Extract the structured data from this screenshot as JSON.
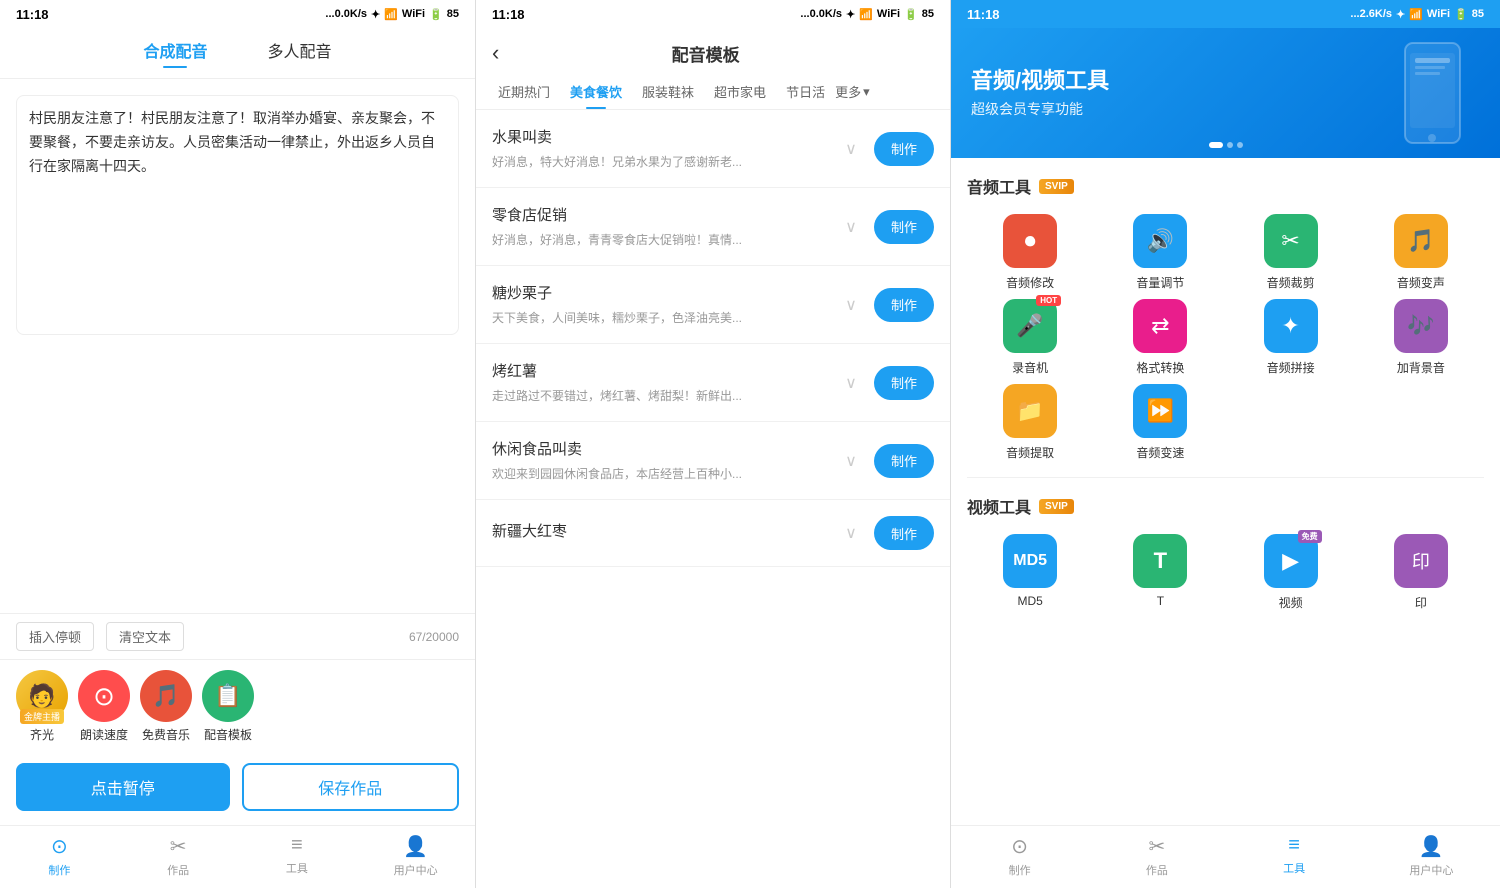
{
  "panel1": {
    "status": {
      "time": "11:18",
      "network": "...0.0K/s",
      "battery": "85"
    },
    "tabs": [
      {
        "label": "合成配音",
        "active": true
      },
      {
        "label": "多人配音",
        "active": false
      }
    ],
    "textarea": {
      "content": "村民朋友注意了！村民朋友注意了！取消举办婚宴、亲友聚会，不要聚餐，不要走亲访友。人员密集活动一律禁止，外出返乡人员自行在家隔离十四天。",
      "placeholder": ""
    },
    "toolbar": {
      "insert_btn": "插入停顿",
      "clear_btn": "清空文本",
      "count": "67/20000"
    },
    "voice_items": [
      {
        "label": "齐光",
        "type": "avatar",
        "badge": "金牌主播"
      },
      {
        "label": "朗读速度",
        "type": "speed"
      },
      {
        "label": "免费音乐",
        "type": "music"
      },
      {
        "label": "配音模板",
        "type": "template"
      }
    ],
    "actions": {
      "pause_btn": "点击暂停",
      "save_btn": "保存作品"
    },
    "bottom_nav": [
      {
        "label": "制作",
        "active": true
      },
      {
        "label": "作品",
        "active": false
      },
      {
        "label": "工具",
        "active": false
      },
      {
        "label": "用户中心",
        "active": false
      }
    ]
  },
  "panel2": {
    "status": {
      "time": "11:18",
      "network": "...0.0K/s",
      "battery": "85"
    },
    "header": {
      "back": "‹",
      "title": "配音模板"
    },
    "categories": [
      {
        "label": "近期热门",
        "active": false
      },
      {
        "label": "美食餐饮",
        "active": true
      },
      {
        "label": "服装鞋袜",
        "active": false
      },
      {
        "label": "超市家电",
        "active": false
      },
      {
        "label": "节日活",
        "active": false
      },
      {
        "label": "更多",
        "active": false
      }
    ],
    "items": [
      {
        "title": "水果叫卖",
        "desc": "好消息，特大好消息！兄弟水果为了感谢新老...",
        "make_btn": "制作"
      },
      {
        "title": "零食店促销",
        "desc": "好消息，好消息，青青零食店大促销啦！真情...",
        "make_btn": "制作"
      },
      {
        "title": "糖炒栗子",
        "desc": "天下美食，人间美味，糯炒栗子，色泽油亮美...",
        "make_btn": "制作"
      },
      {
        "title": "烤红薯",
        "desc": "走过路过不要错过，烤红薯、烤甜梨！新鲜出...",
        "make_btn": "制作"
      },
      {
        "title": "休闲食品叫卖",
        "desc": "欢迎来到园园休闲食品店，本店经营上百种小...",
        "make_btn": "制作"
      },
      {
        "title": "新疆大红枣",
        "desc": "",
        "make_btn": "制作"
      }
    ]
  },
  "panel3": {
    "status": {
      "time": "11:18",
      "network": "...2.6K/s",
      "battery": "85"
    },
    "banner": {
      "title": "音频/视频工具",
      "subtitle": "超级会员专享功能",
      "dots": [
        true,
        false,
        false
      ]
    },
    "audio_tools": {
      "section_title": "音频工具",
      "badge": "SVIP",
      "items": [
        {
          "label": "音频修改",
          "color": "#e8533a",
          "icon": "⏺"
        },
        {
          "label": "音量调节",
          "color": "#1e9ff2",
          "icon": "🔊"
        },
        {
          "label": "音频裁剪",
          "color": "#2ab573",
          "icon": "✂"
        },
        {
          "label": "音频变声",
          "color": "#f5a623",
          "icon": "🎵"
        },
        {
          "label": "录音机",
          "color": "#2ab573",
          "icon": "🎤",
          "hot": true
        },
        {
          "label": "格式转换",
          "color": "#e91e8c",
          "icon": "⇄"
        },
        {
          "label": "音频拼接",
          "color": "#1e9ff2",
          "icon": "✦"
        },
        {
          "label": "加背景音",
          "color": "#9b59b6",
          "icon": "🎶"
        },
        {
          "label": "音频提取",
          "color": "#f5a623",
          "icon": "📁"
        },
        {
          "label": "音频变速",
          "color": "#1e9ff2",
          "icon": "⏩"
        }
      ]
    },
    "video_tools": {
      "section_title": "视频工具",
      "badge": "SVIP",
      "items": [
        {
          "label": "MD5",
          "color": "#1e9ff2",
          "icon": "M"
        },
        {
          "label": "T",
          "color": "#2ab573",
          "icon": "T"
        },
        {
          "label": "视频",
          "color": "#1e9ff2",
          "icon": "▶",
          "free": true
        },
        {
          "label": "印",
          "color": "#9b59b6",
          "icon": "印"
        }
      ]
    },
    "bottom_nav": [
      {
        "label": "制作",
        "active": false
      },
      {
        "label": "作品",
        "active": false
      },
      {
        "label": "工具",
        "active": true
      },
      {
        "label": "用户中心",
        "active": false
      }
    ]
  }
}
